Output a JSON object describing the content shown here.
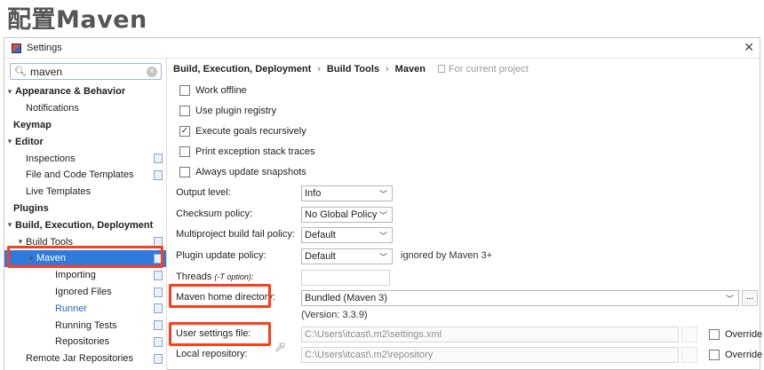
{
  "slide_title": "配置Maven",
  "window": {
    "title": "Settings",
    "close_glyph": "✕"
  },
  "sidebar": {
    "search_value": "maven",
    "items": [
      {
        "label": "Appearance & Behavior",
        "level": 0,
        "bold": true,
        "arrow": "▾"
      },
      {
        "label": "Notifications",
        "level": 1
      },
      {
        "label": "Keymap",
        "level": 0,
        "bold": true
      },
      {
        "label": "Editor",
        "level": 0,
        "bold": true,
        "arrow": "▾"
      },
      {
        "label": "Inspections",
        "level": 1
      },
      {
        "label": "File and Code Templates",
        "level": 1
      },
      {
        "label": "Live Templates",
        "level": 1
      },
      {
        "label": "Plugins",
        "level": 0,
        "bold": true
      },
      {
        "label": "Build, Execution, Deployment",
        "level": 0,
        "bold": true,
        "arrow": "▾"
      },
      {
        "label": "Build Tools",
        "level": 1,
        "arrow": "▾"
      },
      {
        "label": "Maven",
        "level": 2,
        "selected": true,
        "arrow": "▾"
      },
      {
        "label": "Importing",
        "level": 3
      },
      {
        "label": "Ignored Files",
        "level": 3
      },
      {
        "label": "Runner",
        "level": 3,
        "link": true
      },
      {
        "label": "Running Tests",
        "level": 3
      },
      {
        "label": "Repositories",
        "level": 3
      },
      {
        "label": "Remote Jar Repositories",
        "level": 1
      }
    ]
  },
  "breadcrumb": {
    "part1": "Build, Execution, Deployment",
    "part2": "Build Tools",
    "part3": "Maven",
    "separator": "›",
    "scope": "For current project"
  },
  "checkboxes": [
    {
      "label": "Work offline",
      "checked": false
    },
    {
      "label": "Use plugin registry",
      "checked": false
    },
    {
      "label": "Execute goals recursively",
      "checked": true
    },
    {
      "label": "Print exception stack traces",
      "checked": false
    },
    {
      "label": "Always update snapshots",
      "checked": false
    }
  ],
  "fields": {
    "output_level": {
      "label": "Output level:",
      "value": "Info"
    },
    "checksum_policy": {
      "label": "Checksum policy:",
      "value": "No Global Policy"
    },
    "multiproject_fail": {
      "label": "Multiproject build fail policy:",
      "value": "Default"
    },
    "plugin_update": {
      "label": "Plugin update policy:",
      "value": "Default",
      "note": "ignored by Maven 3+"
    },
    "threads": {
      "label": "Threads",
      "hint": "(-T option):"
    },
    "maven_home": {
      "label": "Maven home directory:",
      "value": "Bundled (Maven 3)",
      "version": "(Version: 3.3.9)"
    },
    "user_settings": {
      "label": "User settings file:",
      "value": "C:\\Users\\itcast\\.m2\\settings.xml",
      "override": "Override"
    },
    "local_repo": {
      "label": "Local repository:",
      "value": "C:\\Users\\itcast\\.m2\\repository",
      "override": "Override"
    }
  },
  "colors": {
    "highlight": "#ff3d1a",
    "selection": "#2f7bdc"
  }
}
